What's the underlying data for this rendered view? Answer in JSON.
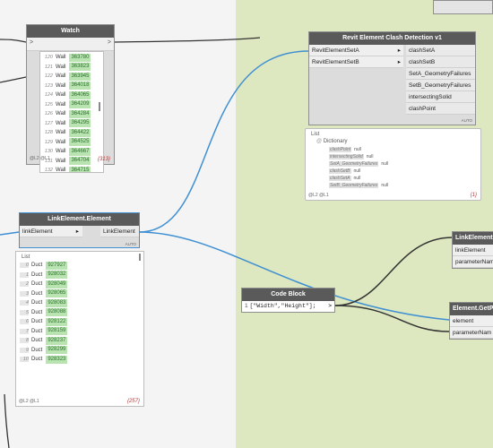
{
  "watch": {
    "title": "Watch",
    "in_arrow": ">",
    "out_arrow": ">",
    "rows": [
      {
        "index": "120",
        "type": "Wall",
        "id": "363780"
      },
      {
        "index": "121",
        "type": "Wall",
        "id": "363823"
      },
      {
        "index": "122",
        "type": "Wall",
        "id": "363945"
      },
      {
        "index": "123",
        "type": "Wall",
        "id": "364018"
      },
      {
        "index": "124",
        "type": "Wall",
        "id": "364065"
      },
      {
        "index": "125",
        "type": "Wall",
        "id": "364209"
      },
      {
        "index": "126",
        "type": "Wall",
        "id": "364284"
      },
      {
        "index": "127",
        "type": "Wall",
        "id": "364295"
      },
      {
        "index": "128",
        "type": "Wall",
        "id": "364422"
      },
      {
        "index": "129",
        "type": "Wall",
        "id": "364525"
      },
      {
        "index": "130",
        "type": "Wall",
        "id": "364667"
      },
      {
        "index": "131",
        "type": "Wall",
        "id": "364704"
      },
      {
        "index": "132",
        "type": "Wall",
        "id": "364715"
      }
    ],
    "levels": "@L2 @L1",
    "count": "{313}"
  },
  "clash": {
    "title": "Revit Element Clash Detection v1",
    "inputs": [
      "RevitElementSetA",
      "RevitElementSetB"
    ],
    "outputs": [
      "clashSetA",
      "clashSetB",
      "SetA_GeometryFailures",
      "SetB_GeometryFailures",
      "intersectingSolid",
      "clashPoint"
    ],
    "auto": "AUTO",
    "preview": {
      "list_label": "List",
      "dict_label": "Dictionary",
      "entries": [
        {
          "key": "clashPoint",
          "value": "null"
        },
        {
          "key": "intersectingSolid",
          "value": "null"
        },
        {
          "key": "SetA_GeometryFailures",
          "value": "null"
        },
        {
          "key": "clashSetB",
          "value": "null"
        },
        {
          "key": "clashSetA",
          "value": "null"
        },
        {
          "key": "SetB_GeometryFailures",
          "value": "null"
        }
      ],
      "levels": "@L2 @L1",
      "count": "{1}"
    }
  },
  "link": {
    "title": "LinkElement.Element",
    "input": "linkElement",
    "output": "LinkElement",
    "auto": "AUTO",
    "preview": {
      "list_label": "List",
      "rows": [
        {
          "index": "0",
          "type": "Duct",
          "id": "927927"
        },
        {
          "index": "1",
          "type": "Duct",
          "id": "928032"
        },
        {
          "index": "2",
          "type": "Duct",
          "id": "928049"
        },
        {
          "index": "3",
          "type": "Duct",
          "id": "928065"
        },
        {
          "index": "4",
          "type": "Duct",
          "id": "928083"
        },
        {
          "index": "5",
          "type": "Duct",
          "id": "928088"
        },
        {
          "index": "6",
          "type": "Duct",
          "id": "928122"
        },
        {
          "index": "7",
          "type": "Duct",
          "id": "928159"
        },
        {
          "index": "8",
          "type": "Duct",
          "id": "928237"
        },
        {
          "index": "9",
          "type": "Duct",
          "id": "928299"
        },
        {
          "index": "10",
          "type": "Duct",
          "id": "928323"
        }
      ],
      "levels": "@L2 @L1",
      "count": "{257}"
    }
  },
  "codeblock": {
    "title": "Code Block",
    "line_number": "1",
    "code": "[\"Width\",\"Height\"];",
    "out_arrow": ">"
  },
  "link_partial": {
    "title": "LinkElement.G",
    "ports": [
      "linkElement",
      "parameterNam"
    ]
  },
  "getparam_partial": {
    "title": "Element.GetPa",
    "ports": [
      "element",
      "parameterNam"
    ]
  },
  "colors": {
    "wire": "#3f8fd2",
    "wire_dark": "#333333",
    "selected_border": "#3f8fd2",
    "green_area": "#dde8c0",
    "id_green": "#b9e4b2"
  }
}
